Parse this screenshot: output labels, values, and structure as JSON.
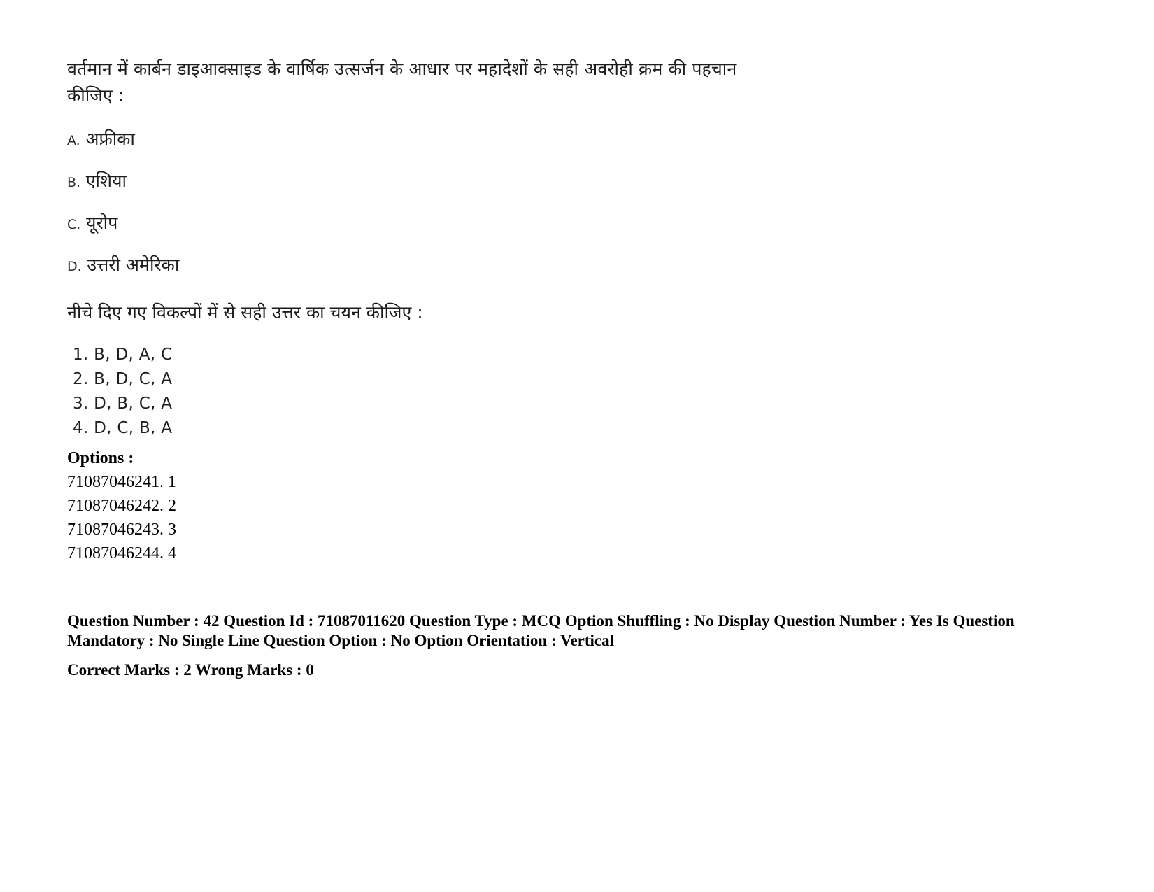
{
  "document": {
    "type": "exam-question-page",
    "background_color": "#ffffff",
    "text_color": "#1a1a1a"
  },
  "question": {
    "stem_line1": "वर्तमान में कार्बन डाइआक्साइड के वार्षिक उत्सर्जन के आधार पर महादेशों के सही अवरोही क्रम की पहचान",
    "stem_line2": "कीजिए :",
    "statements": [
      {
        "letter": "A.",
        "text": "अफ्रीका"
      },
      {
        "letter": "B.",
        "text": "एशिया"
      },
      {
        "letter": "C.",
        "text": "यूरोप"
      },
      {
        "letter": "D.",
        "text": "उत्तरी अमेरिका"
      }
    ],
    "leadin": "नीचे दिए गए विकल्पों में से सही उत्तर का चयन कीजिए :",
    "choices": [
      "1. B, D, A, C",
      "2. B, D, C, A",
      "3. D, B, C, A",
      "4. D, C, B, A"
    ]
  },
  "options": {
    "title": "Options :",
    "rows": [
      "71087046241. 1",
      "71087046242. 2",
      "71087046243. 3",
      "71087046244. 4"
    ]
  },
  "metadata": {
    "line1": "Question Number : 42 Question Id : 71087011620 Question Type : MCQ Option Shuffling : No Display Question Number : Yes Is",
    "line2": "Question Mandatory : No Single Line Question Option : No Option Orientation : Vertical",
    "line3": "Correct Marks : 2 Wrong Marks : 0"
  }
}
